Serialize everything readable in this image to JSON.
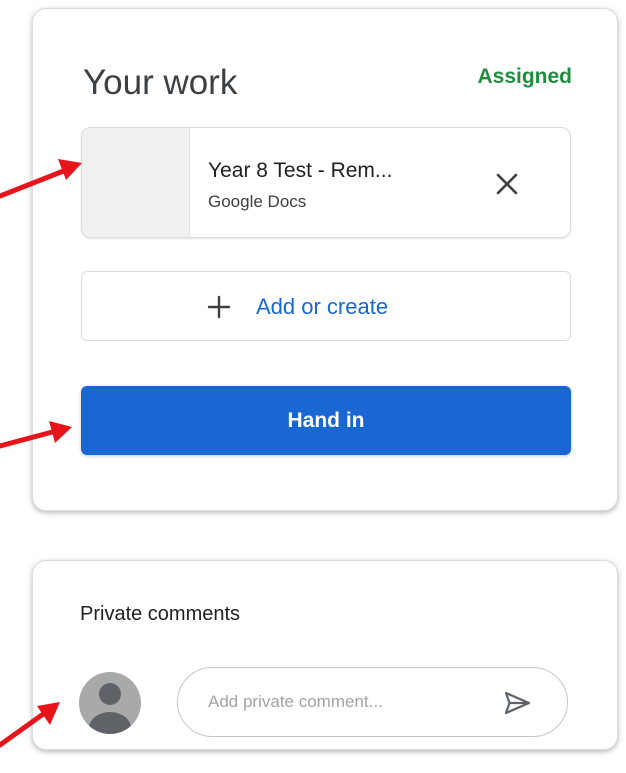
{
  "your_work": {
    "title": "Your work",
    "status": "Assigned",
    "status_color": "#1e8e3e",
    "attachment": {
      "name": "Year 8 Test - Rem...",
      "type": "Google Docs",
      "remove_icon": "close-icon"
    },
    "add_button": {
      "label": "Add or create",
      "icon": "plus-icon"
    },
    "hand_in_button": {
      "label": "Hand in",
      "color": "#1967d2"
    }
  },
  "private_comments": {
    "title": "Private comments",
    "avatar_icon": "person-icon",
    "input": {
      "value": "",
      "placeholder": "Add private comment..."
    },
    "send_icon": "send-icon"
  },
  "annotations": {
    "arrow_color": "#e8141c",
    "arrow_count": 3
  }
}
